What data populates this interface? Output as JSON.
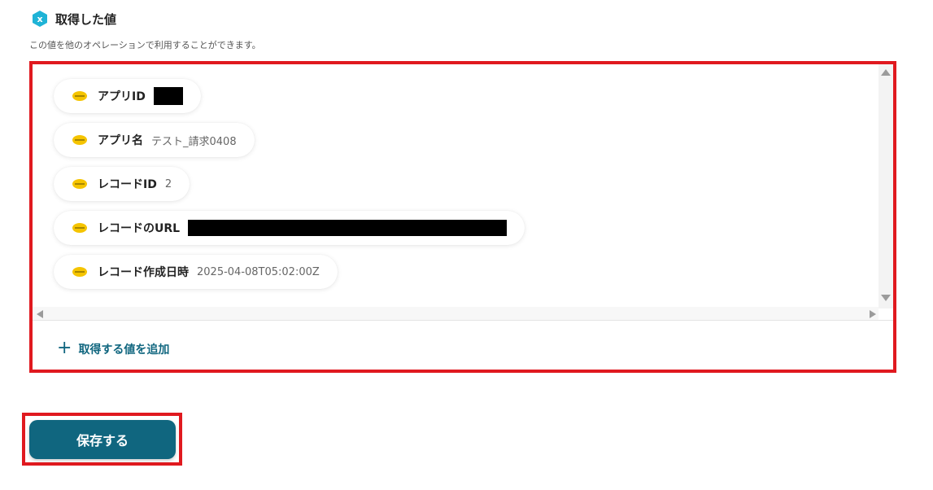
{
  "section": {
    "title": "取得した値",
    "description": "この値を他のオペレーションで利用することができます。"
  },
  "fields": [
    {
      "label": "アプリID",
      "value": "",
      "redacted": true
    },
    {
      "label": "アプリ名",
      "value": "テスト_請求0408",
      "redacted": false
    },
    {
      "label": "レコードID",
      "value": "2",
      "redacted": false
    },
    {
      "label": "レコードのURL",
      "value": "",
      "redacted": true
    },
    {
      "label": "レコード作成日時",
      "value": "2025-04-08T05:02:00Z",
      "redacted": false
    }
  ],
  "add_value_label": "取得する値を追加",
  "save_label": "保存する",
  "colors": {
    "accent": "#10667f",
    "highlight": "#e0191f",
    "section_icon": "#1fb3d6",
    "app_icon": "#f5c400"
  }
}
